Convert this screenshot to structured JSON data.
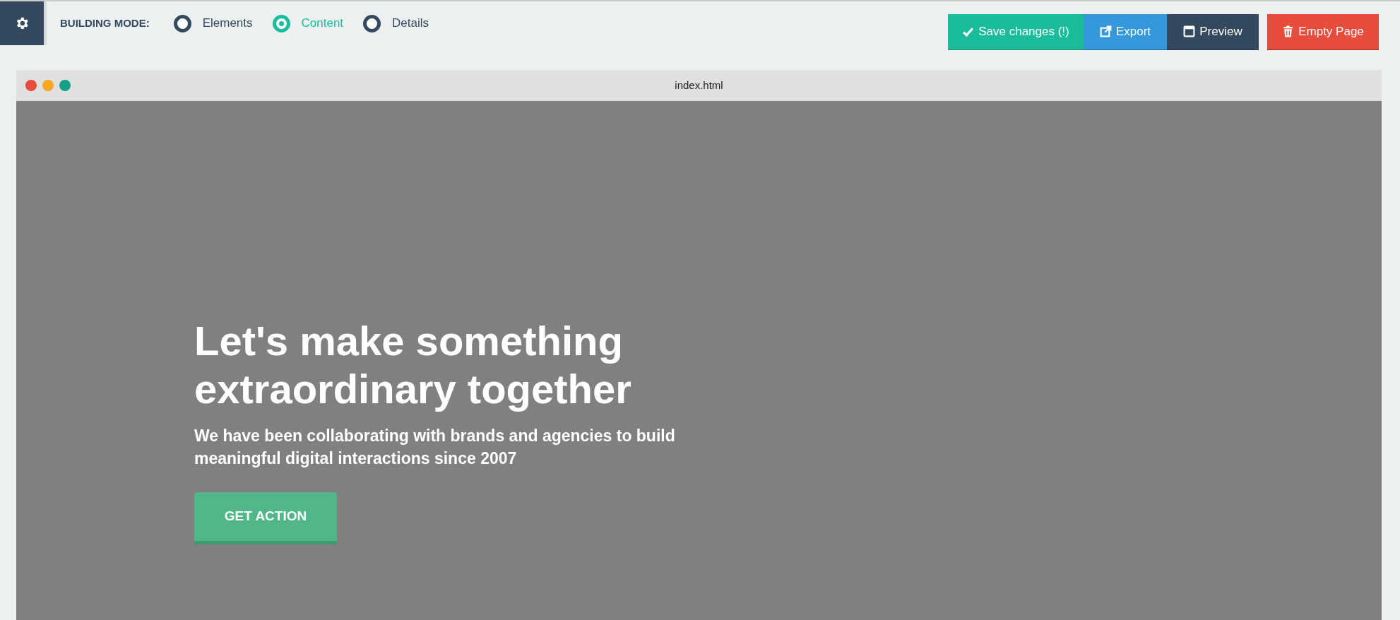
{
  "toolbar": {
    "mode_label": "BUILDING MODE:",
    "modes": [
      {
        "label": "Elements",
        "selected": false
      },
      {
        "label": "Content",
        "selected": true
      },
      {
        "label": "Details",
        "selected": false
      }
    ],
    "buttons": [
      {
        "kind": "save",
        "label": "Save changes (!)"
      },
      {
        "kind": "export",
        "label": "Export"
      },
      {
        "kind": "preview",
        "label": "Preview"
      },
      {
        "kind": "empty",
        "label": "Empty Page"
      }
    ]
  },
  "preview": {
    "title": "index.html",
    "hero": {
      "heading": "Let's make something extraordinary together",
      "subheading": "We have been collaborating with brands and agencies to build meaningful digital interactions since 2007",
      "button": "GET ACTION"
    }
  }
}
